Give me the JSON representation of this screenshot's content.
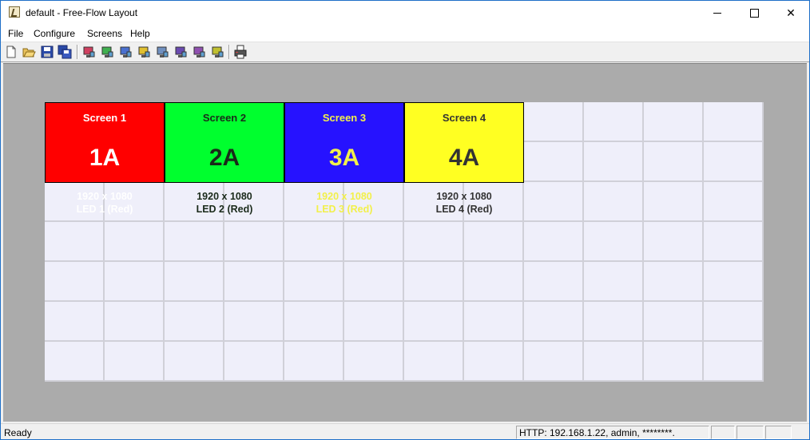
{
  "window": {
    "title": "default - Free-Flow Layout"
  },
  "menu": [
    "File",
    "Configure",
    "Screens",
    "Help"
  ],
  "toolbar": {
    "buttons": [
      {
        "name": "new-icon"
      },
      {
        "name": "open-icon"
      },
      {
        "name": "save-icon"
      },
      {
        "name": "save-all-icon"
      },
      {
        "name": "screen-tool-1-icon"
      },
      {
        "name": "screen-tool-2-icon"
      },
      {
        "name": "screen-tool-3-icon"
      },
      {
        "name": "screen-tool-4-icon"
      },
      {
        "name": "screen-tool-5-icon"
      },
      {
        "name": "screen-tool-6-icon"
      },
      {
        "name": "screen-tool-7-icon"
      },
      {
        "name": "screen-tool-8-icon"
      },
      {
        "name": "print-icon"
      }
    ]
  },
  "grid": {
    "columns": 12,
    "rows": 7,
    "canvas_color": "#efeffa",
    "line_color": "#d0d0d8",
    "workspace_color": "#ababab"
  },
  "screens": [
    {
      "name": "Screen 1",
      "id": "1A",
      "resolution": "1920 x 1080",
      "led": "LED 1 (Red)",
      "bg": "#ff0000",
      "fg": "#ffffff",
      "id_color": "#ffffff"
    },
    {
      "name": "Screen 2",
      "id": "2A",
      "resolution": "1920 x 1080",
      "led": "LED 2 (Red)",
      "bg": "#00ff2e",
      "fg": "#1a2a1a",
      "id_color": "#1a2a1a"
    },
    {
      "name": "Screen 3",
      "id": "3A",
      "resolution": "1920 x 1080",
      "led": "LED 3 (Red)",
      "bg": "#2612ff",
      "fg": "#f2f04a",
      "id_color": "#f2f04a"
    },
    {
      "name": "Screen 4",
      "id": "4A",
      "resolution": "1920 x 1080",
      "led": "LED 4 (Red)",
      "bg": "#ffff22",
      "fg": "#333333",
      "id_color": "#333333"
    }
  ],
  "status": {
    "left": "Ready",
    "http": "HTTP: 192.168.1.22, admin, ********."
  }
}
